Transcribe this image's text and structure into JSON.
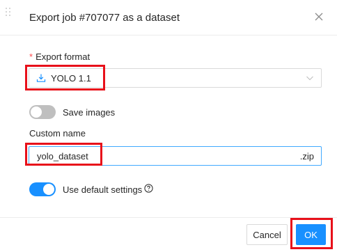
{
  "modal": {
    "title": "Export job #707077 as a dataset",
    "close_icon": "close-x-icon"
  },
  "form": {
    "export_format": {
      "required_mark": "*",
      "label": "Export format",
      "icon": "download-icon",
      "selected_value": "YOLO 1.1",
      "dropdown_icon": "chevron-down-icon"
    },
    "save_images": {
      "label": "Save images",
      "checked": false
    },
    "custom_name": {
      "label": "Custom name",
      "value": "yolo_dataset",
      "suffix": ".zip"
    },
    "use_default_settings": {
      "label": "Use default settings",
      "checked": true,
      "help_icon": "question-circle-icon"
    }
  },
  "footer": {
    "cancel_label": "Cancel",
    "ok_label": "OK"
  },
  "colors": {
    "primary": "#1890ff",
    "required": "#ff4d4f",
    "annotation_box": "#e8101a",
    "toggle_off": "#bfbfbf"
  }
}
